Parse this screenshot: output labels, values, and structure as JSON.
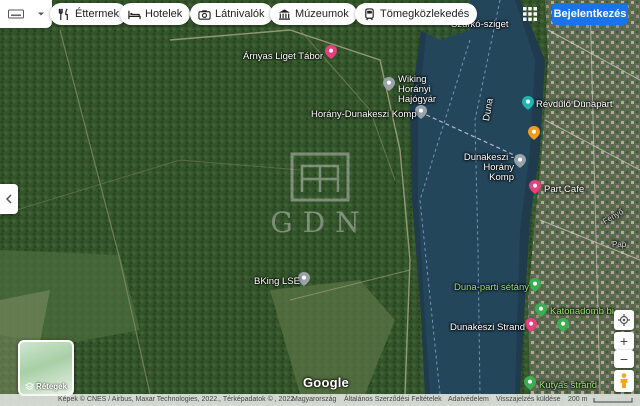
{
  "chips": [
    {
      "label": "Éttermek",
      "icon": "fork-knife-icon"
    },
    {
      "label": "Hotelek",
      "icon": "bed-icon"
    },
    {
      "label": "Látnivalók",
      "icon": "camera-icon"
    },
    {
      "label": "Múzeumok",
      "icon": "museum-icon"
    },
    {
      "label": "Tömegközlekedés",
      "icon": "transit-icon"
    }
  ],
  "header": {
    "signin_label": "Bejelentkezés"
  },
  "places": {
    "arnyas": "Árnyas Liget Tábor",
    "wiking": "Wiking Horányi Hajógyár",
    "horany_komp": "Horány-Dunakeszi Komp",
    "dunakeszi_komp": "Dunakeszi - Horány Komp",
    "revdulo": "Révdűlő Dunapart",
    "part_cafe": "Part Cafe",
    "bking": "BKing LSE",
    "duna_setany": "Duna-parti sétány",
    "katonadomb": "Katonadomb bi...",
    "dunakeszi_strand": "Dunakeszi Strand",
    "kutyas_strand": "Kutyás strand",
    "szurko": "Szurkó-sziget",
    "duna": "Duna",
    "fenyo": "Fenyő",
    "pap": "Pap"
  },
  "watermark": {
    "text": "GDN"
  },
  "layers": {
    "label": "Rétegek"
  },
  "zoom": {
    "in": "+",
    "out": "−"
  },
  "footer": {
    "imagery": "Képek © CNES / Airbus, Maxar Technologies, 2022., Térképadatok © , 2022.",
    "country": "Magyarország",
    "terms": "Általános Szerződési Feltételek",
    "privacy": "Adatvédelem",
    "feedback": "Visszajelzés küldése",
    "scale": "200 m"
  },
  "brand": {
    "google": "Google"
  },
  "colors": {
    "accent": "#1a73e8",
    "pin": "#e8407d",
    "pin_gray": "#9aa3ab"
  }
}
